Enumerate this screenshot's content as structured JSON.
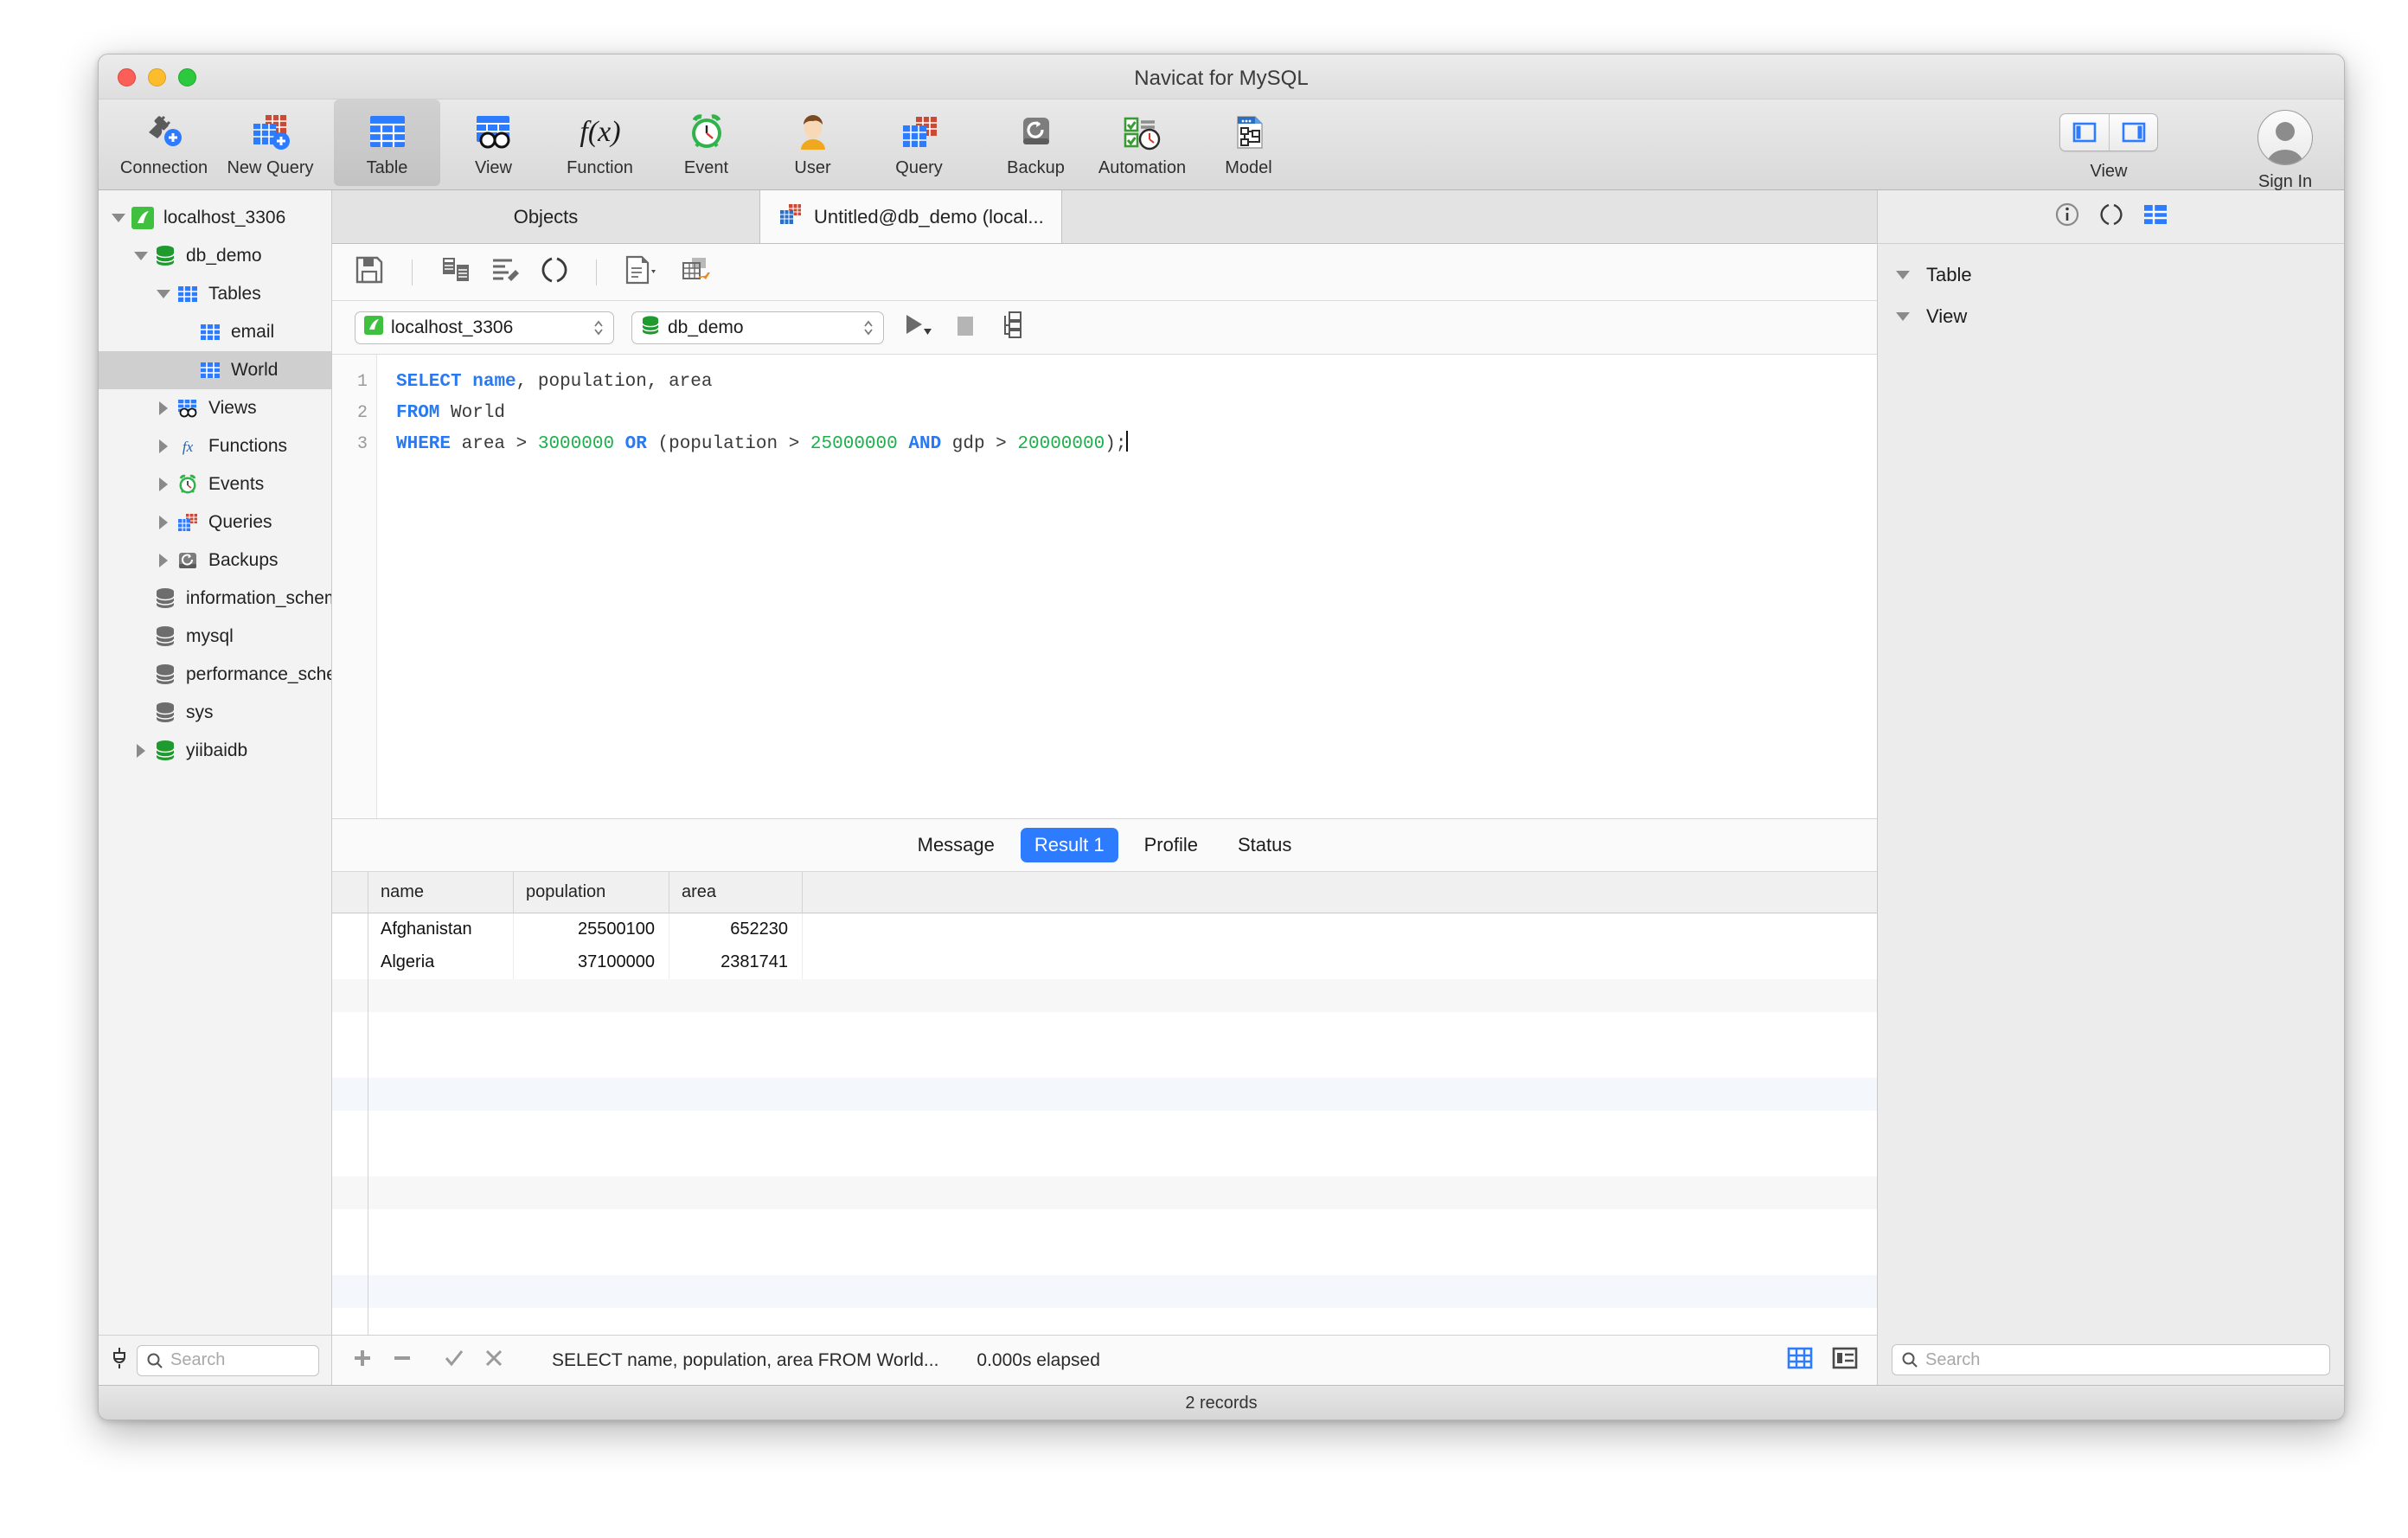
{
  "window": {
    "title": "Navicat for MySQL",
    "traffic_lights": [
      "close",
      "minimize",
      "maximize"
    ]
  },
  "toolbar": {
    "items": [
      {
        "label": "Connection",
        "icon": "connection-plus-icon",
        "active": false
      },
      {
        "label": "New Query",
        "icon": "new-query-icon",
        "active": false
      },
      {
        "label": "Table",
        "icon": "table-icon",
        "active": true
      },
      {
        "label": "View",
        "icon": "view-icon",
        "active": false
      },
      {
        "label": "Function",
        "icon": "function-icon",
        "active": false
      },
      {
        "label": "Event",
        "icon": "event-clock-icon",
        "active": false
      },
      {
        "label": "User",
        "icon": "user-icon",
        "active": false
      },
      {
        "label": "Query",
        "icon": "query-icon",
        "active": false
      },
      {
        "label": "Backup",
        "icon": "backup-icon",
        "active": false
      },
      {
        "label": "Automation",
        "icon": "automation-icon",
        "active": false
      },
      {
        "label": "Model",
        "icon": "model-icon",
        "active": false
      }
    ],
    "view_group_label": "View",
    "sign_in_label": "Sign In"
  },
  "sidebar": {
    "tree": [
      {
        "label": "localhost_3306",
        "icon": "navicat-connection-icon",
        "indent": 0,
        "twisty": "down",
        "selected": false
      },
      {
        "label": "db_demo",
        "icon": "database-green-icon",
        "indent": 1,
        "twisty": "down",
        "selected": false
      },
      {
        "label": "Tables",
        "icon": "tables-icon",
        "indent": 2,
        "twisty": "down",
        "selected": false
      },
      {
        "label": "email",
        "icon": "table-icon",
        "indent": 3,
        "twisty": "none",
        "selected": false
      },
      {
        "label": "World",
        "icon": "table-icon",
        "indent": 3,
        "twisty": "none",
        "selected": true
      },
      {
        "label": "Views",
        "icon": "views-icon",
        "indent": 2,
        "twisty": "right",
        "selected": false
      },
      {
        "label": "Functions",
        "icon": "functions-fx-icon",
        "indent": 2,
        "twisty": "right",
        "selected": false
      },
      {
        "label": "Events",
        "icon": "events-clock-icon",
        "indent": 2,
        "twisty": "right",
        "selected": false
      },
      {
        "label": "Queries",
        "icon": "queries-icon",
        "indent": 2,
        "twisty": "right",
        "selected": false
      },
      {
        "label": "Backups",
        "icon": "backups-icon",
        "indent": 2,
        "twisty": "right",
        "selected": false
      },
      {
        "label": "information_schema",
        "icon": "database-gray-icon",
        "indent": 1,
        "twisty": "none",
        "selected": false
      },
      {
        "label": "mysql",
        "icon": "database-gray-icon",
        "indent": 1,
        "twisty": "none",
        "selected": false
      },
      {
        "label": "performance_schema",
        "icon": "database-gray-icon",
        "indent": 1,
        "twisty": "none",
        "selected": false
      },
      {
        "label": "sys",
        "icon": "database-gray-icon",
        "indent": 1,
        "twisty": "none",
        "selected": false
      },
      {
        "label": "yiibaidb",
        "icon": "database-green-icon",
        "indent": 1,
        "twisty": "right",
        "selected": false
      }
    ],
    "search_placeholder": "Search"
  },
  "tabs": {
    "objects_label": "Objects",
    "query_tab_label": "Untitled@db_demo (local...",
    "query_tab_icon": "query-tab-icon"
  },
  "editor_toolbar": {
    "icons": [
      "save-icon",
      "copy-icon",
      "beautify-sql-icon",
      "parentheses-icon",
      "document-dropdown-icon",
      "export-table-icon"
    ]
  },
  "connection_bar": {
    "connection_value": "localhost_3306",
    "database_value": "db_demo",
    "run_icon": "run-play-icon",
    "stop_icon": "stop-icon",
    "explain_icon": "explain-plan-icon"
  },
  "sql": {
    "line_numbers": [
      "1",
      "2",
      "3"
    ],
    "lines": [
      [
        {
          "t": "SELECT",
          "c": "kw"
        },
        {
          "t": " ",
          "c": ""
        },
        {
          "t": "name",
          "c": "kw"
        },
        {
          "t": ", population, area",
          "c": ""
        }
      ],
      [
        {
          "t": "FROM",
          "c": "kw"
        },
        {
          "t": " World",
          "c": ""
        }
      ],
      [
        {
          "t": "WHERE",
          "c": "kw"
        },
        {
          "t": " area > ",
          "c": ""
        },
        {
          "t": "3000000",
          "c": "num"
        },
        {
          "t": " ",
          "c": ""
        },
        {
          "t": "OR",
          "c": "kw"
        },
        {
          "t": " (population > ",
          "c": ""
        },
        {
          "t": "25000000",
          "c": "num"
        },
        {
          "t": " ",
          "c": ""
        },
        {
          "t": "AND",
          "c": "kw"
        },
        {
          "t": " gdp > ",
          "c": ""
        },
        {
          "t": "20000000",
          "c": "num"
        },
        {
          "t": ");",
          "c": ""
        }
      ]
    ]
  },
  "result_tabs": [
    {
      "label": "Message",
      "active": false
    },
    {
      "label": "Result 1",
      "active": true
    },
    {
      "label": "Profile",
      "active": false
    },
    {
      "label": "Status",
      "active": false
    }
  ],
  "result_grid": {
    "columns": [
      "name",
      "population",
      "area"
    ],
    "rows": [
      [
        "Afghanistan",
        "25500100",
        "652230"
      ],
      [
        "Algeria",
        "37100000",
        "2381741"
      ]
    ]
  },
  "grid_footer": {
    "add_icon": "plus-icon",
    "remove_icon": "minus-icon",
    "confirm_icon": "check-icon",
    "cancel_icon": "cross-icon",
    "sql_text": "SELECT name, population, area FROM World...",
    "elapsed": "0.000s elapsed",
    "grid_view_icon": "grid-view-icon",
    "form_view_icon": "form-view-icon"
  },
  "right_panel": {
    "top_icons": [
      "info-icon",
      "parentheses-icon",
      "grid-blue-icon"
    ],
    "sections": [
      {
        "label": "Table",
        "twisty": "down"
      },
      {
        "label": "View",
        "twisty": "down"
      }
    ],
    "search_placeholder": "Search"
  },
  "status_bar": {
    "records": "2 records"
  },
  "colors": {
    "accent_blue": "#2d7bff",
    "keyword_blue": "#2979f2",
    "number_green": "#1cb14a",
    "selection_gray": "#cfcfcf",
    "db_green": "#1f9a2e"
  }
}
